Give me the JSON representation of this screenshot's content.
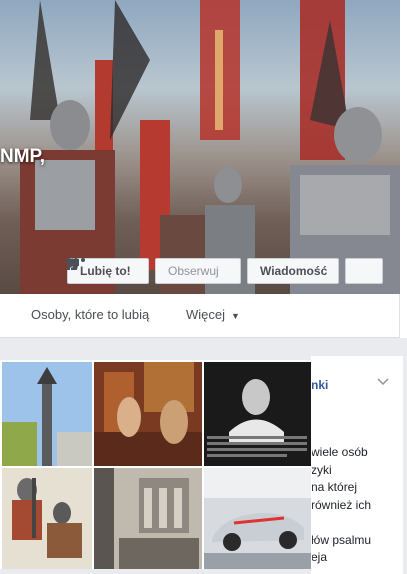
{
  "page": {
    "name": "NMP,"
  },
  "actions": {
    "like_label": "Lubię to!",
    "follow_label": "Obserwuj",
    "message_label": "Wiadomość"
  },
  "tabs": {
    "people": "Osoby, które to lubią",
    "more": "Więcej"
  },
  "side": {
    "title": "nki",
    "lines": [
      "wiele osób",
      "zyki",
      "na której",
      "również ich",
      "",
      "łów psalmu",
      "eja"
    ]
  },
  "photo_caption_text": "Wiele osób mówi..."
}
